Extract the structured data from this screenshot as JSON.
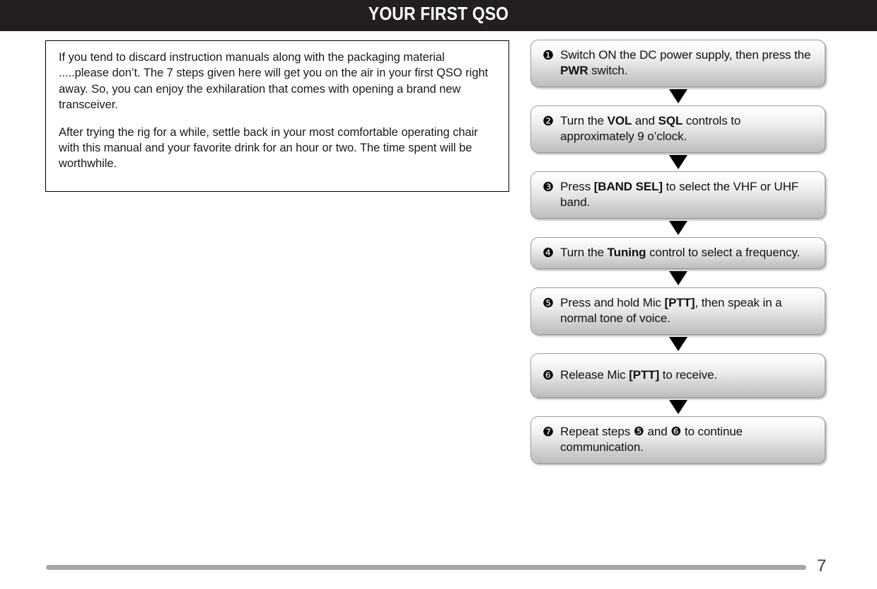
{
  "header": {
    "title": "YOUR FIRST QSO"
  },
  "intro": {
    "paragraphs": [
      "If you tend to discard instruction manuals along with the packaging material .....please don’t.  The 7 steps given here will get you on the air in your first QSO right away.  So, you can enjoy the exhilaration that comes with opening a brand new transceiver.",
      "After trying the rig for a while, settle back in your most comfortable operating chair with this manual and your favorite drink for an hour or two.  The time spent will be worthwhile."
    ]
  },
  "flow": {
    "arrow_glyph": "▼",
    "steps": [
      {
        "number": "❶",
        "segments": [
          {
            "text": "Switch ON the DC power supply, then press the ",
            "bold": false
          },
          {
            "text": "PWR",
            "bold": true
          },
          {
            "text": " switch.",
            "bold": false
          }
        ],
        "lines": 2
      },
      {
        "number": "❷",
        "segments": [
          {
            "text": "Turn the ",
            "bold": false
          },
          {
            "text": "VOL",
            "bold": true
          },
          {
            "text": " and ",
            "bold": false
          },
          {
            "text": "SQL",
            "bold": true
          },
          {
            "text": " controls to approximately 9 o’clock.",
            "bold": false
          }
        ],
        "lines": 2
      },
      {
        "number": "❸",
        "segments": [
          {
            "text": "Press ",
            "bold": false
          },
          {
            "text": "[BAND SEL]",
            "bold": true
          },
          {
            "text": " to select the VHF or UHF band.",
            "bold": false
          }
        ],
        "lines": 2
      },
      {
        "number": "❹",
        "segments": [
          {
            "text": "Turn the ",
            "bold": false
          },
          {
            "text": "Tuning",
            "bold": true
          },
          {
            "text": " control to select a frequency.",
            "bold": false
          }
        ],
        "lines": 2
      },
      {
        "number": "❺",
        "segments": [
          {
            "text": "Press and hold Mic ",
            "bold": false
          },
          {
            "text": "[PTT]",
            "bold": true
          },
          {
            "text": ", then speak in a normal tone of voice.",
            "bold": false
          }
        ],
        "lines": 2
      },
      {
        "number": "❻",
        "segments": [
          {
            "text": "Release Mic ",
            "bold": false
          },
          {
            "text": "[PTT]",
            "bold": true
          },
          {
            "text": " to receive.",
            "bold": false
          }
        ],
        "lines": 1
      },
      {
        "number": "❼",
        "segments": [
          {
            "text": "Repeat steps ❺ and ❻ to continue communication.",
            "bold": false
          }
        ],
        "lines": 2
      }
    ]
  },
  "footer": {
    "page_number": "7"
  },
  "colors": {
    "header_background": "#231f20",
    "header_text": "#ffffff",
    "box_border": "#9b9b9b",
    "box_gradient_top": "#ffffff",
    "box_gradient_bottom": "#bdbdbd",
    "rule": "#a7a7a7",
    "body_text": "#1a1a1a"
  }
}
